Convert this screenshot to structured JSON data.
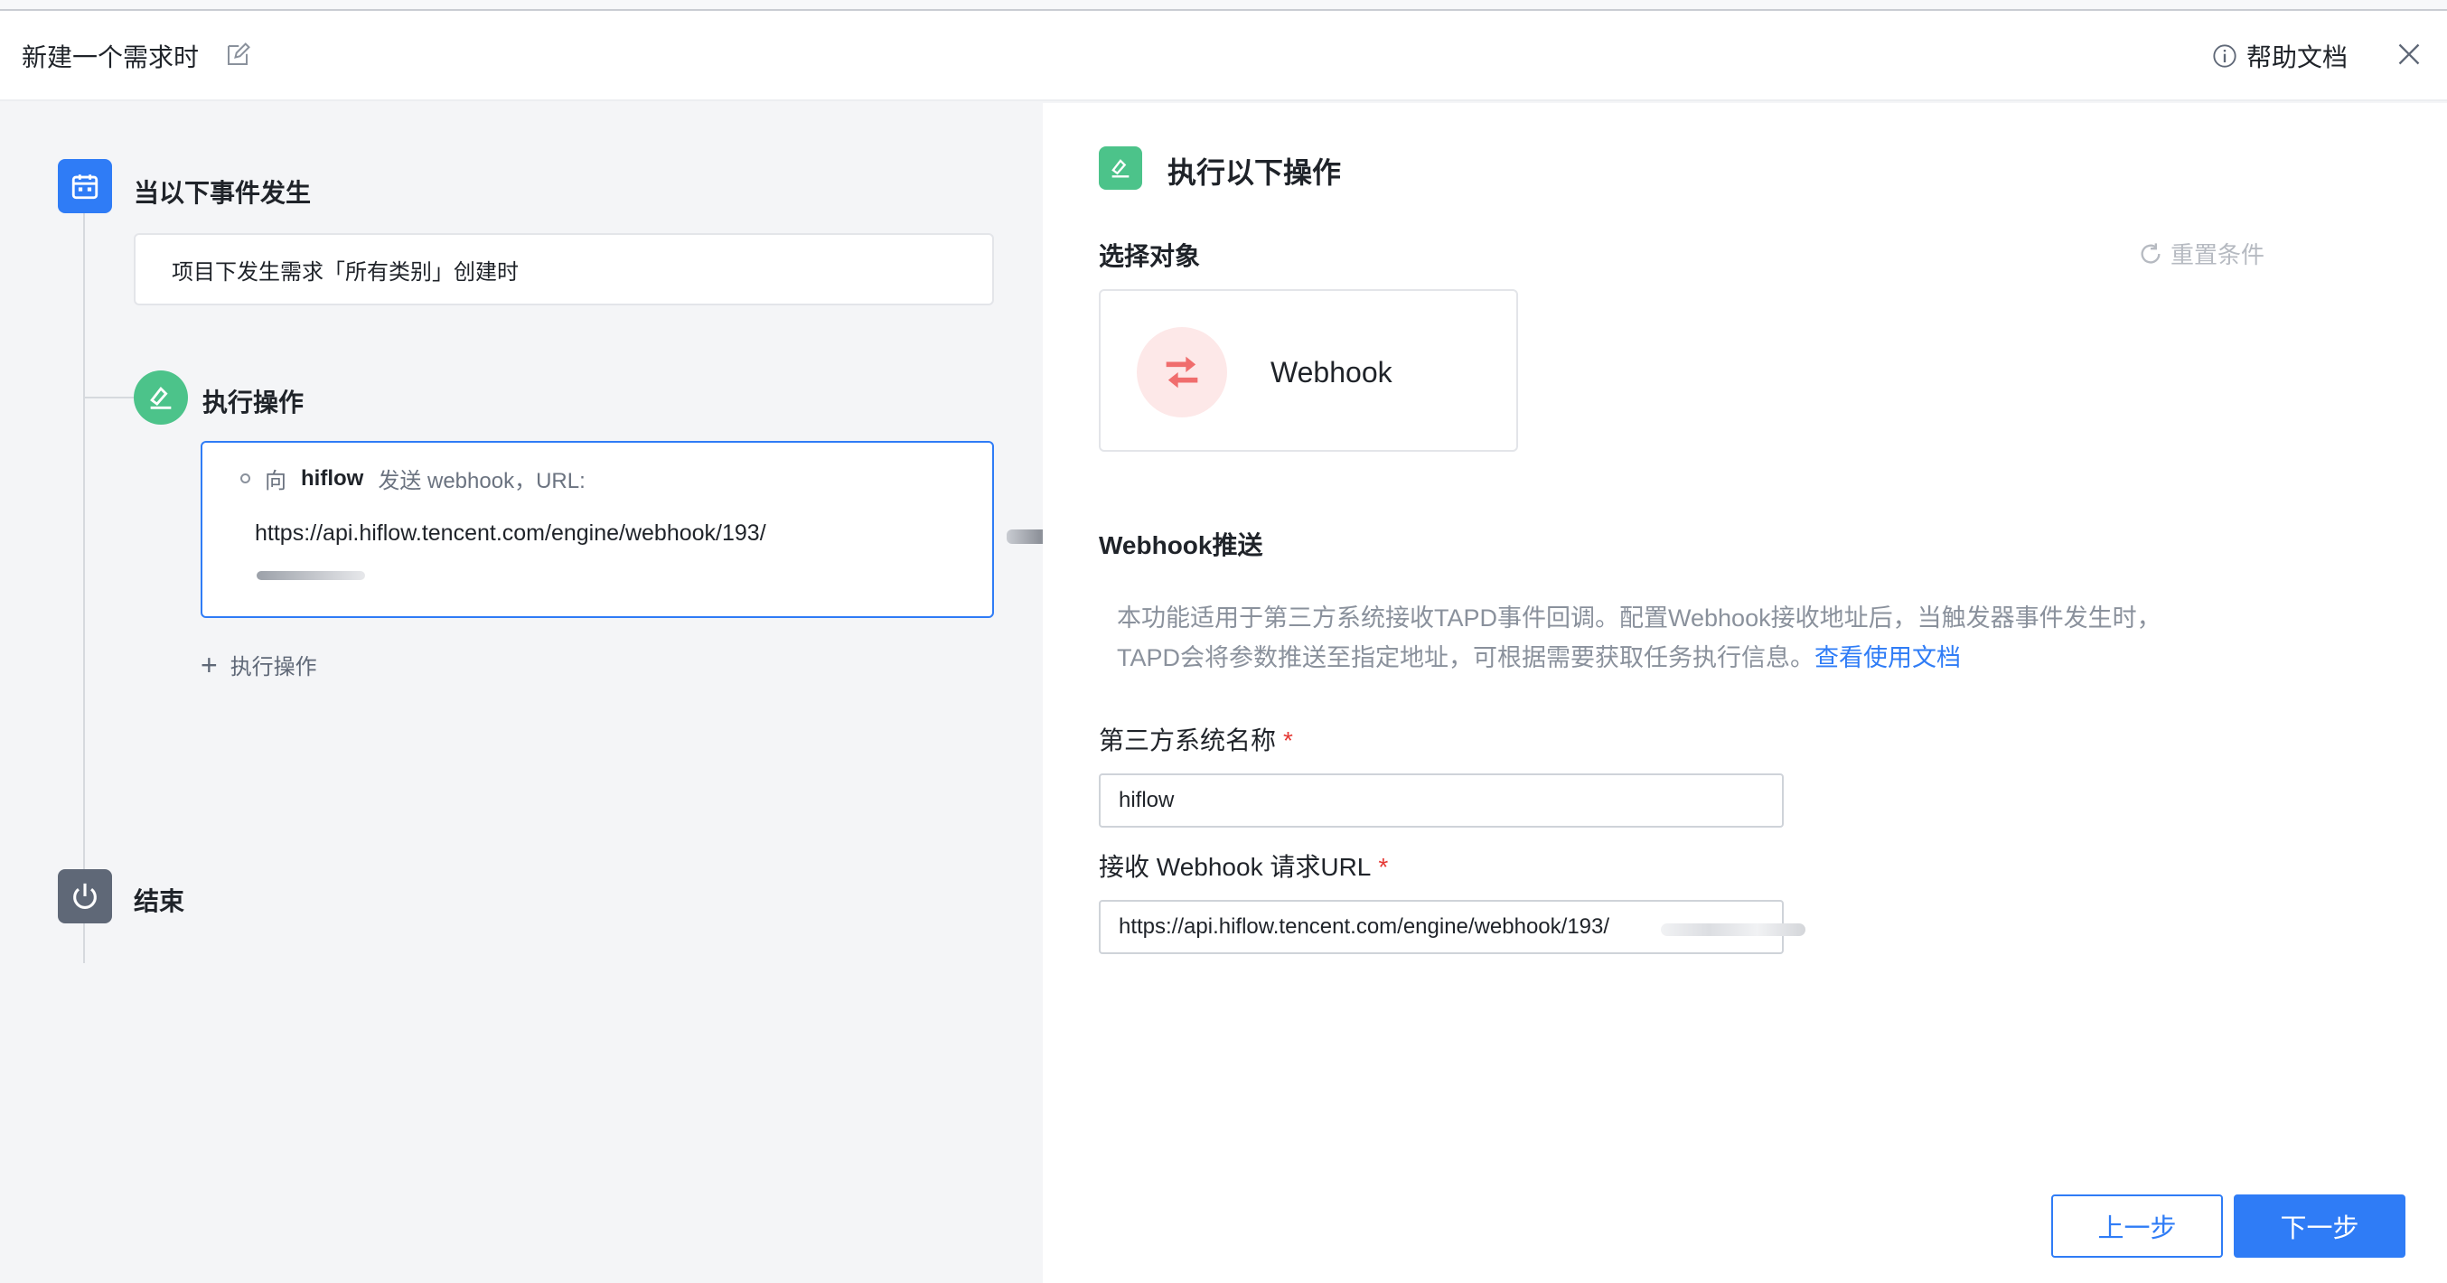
{
  "header": {
    "title": "新建一个需求时",
    "help_label": "帮助文档"
  },
  "left": {
    "trigger": {
      "label": "当以下事件发生",
      "description": "项目下发生需求「所有类别」创建时"
    },
    "action": {
      "label": "执行操作",
      "prefix": "向",
      "target": "hiflow",
      "middle": "发送 webhook，URL:",
      "url": "https://api.hiflow.tencent.com/engine/webhook/193/"
    },
    "add_action_label": "执行操作",
    "end_label": "结束"
  },
  "right": {
    "title": "执行以下操作",
    "select_object_label": "选择对象",
    "reset_label": "重置条件",
    "webhook_card_name": "Webhook",
    "push_title": "Webhook推送",
    "description_line1": "本功能适用于第三方系统接收TAPD事件回调。配置Webhook接收地址后，当触发器事件发生时，",
    "description_line2": "TAPD会将参数推送至指定地址，可根据需要获取任务执行信息。",
    "doc_link": "查看使用文档",
    "fields": {
      "system_name_label": "第三方系统名称",
      "system_name_value": "hiflow",
      "url_label": "接收 Webhook 请求URL",
      "url_value": "https://api.hiflow.tencent.com/engine/webhook/193/",
      "required_mark": "*"
    },
    "buttons": {
      "prev": "上一步",
      "next": "下一步"
    }
  },
  "colors": {
    "primary": "#2f7cf6",
    "success": "#4cc38a",
    "danger": "#e53935",
    "webhook_icon": "#f06d6d"
  }
}
